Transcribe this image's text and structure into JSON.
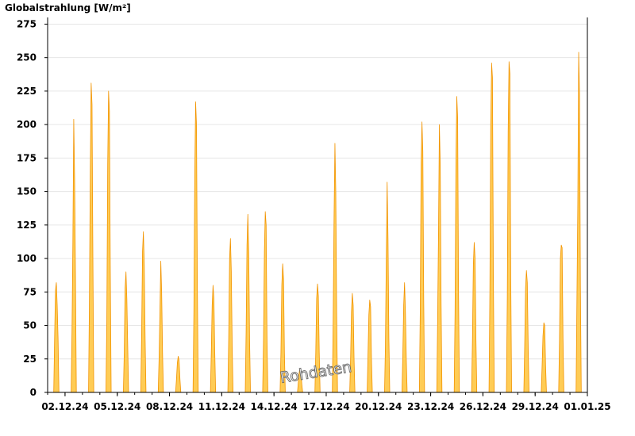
{
  "chart_data": {
    "type": "area",
    "ylabel": "Globalstrahlung [W/m²]",
    "watermark": "Rohdaten",
    "x_ticks": [
      "02.12.24",
      "05.12.24",
      "08.12.24",
      "11.12.24",
      "14.12.24",
      "17.12.24",
      "20.12.24",
      "23.12.24",
      "26.12.24",
      "29.12.24",
      "01.01.25"
    ],
    "y_ticks": [
      0,
      25,
      50,
      75,
      100,
      125,
      150,
      175,
      200,
      225,
      250,
      275
    ],
    "ylim": [
      0,
      280
    ],
    "xlim": [
      "01.12.24",
      "01.01.25"
    ],
    "grid": true,
    "colors": {
      "fill": "#ffcc55",
      "stroke": "#f29400",
      "grid": "#e6e6e6"
    },
    "series": [
      {
        "daily": [
          {
            "date": "01.12.24",
            "peak": 82,
            "shape": [
              0,
              40,
              76,
              82,
              65,
              40,
              0
            ]
          },
          {
            "date": "02.12.24",
            "peak": 204,
            "shape": [
              0,
              45,
              112,
              204,
              160,
              85,
              0
            ]
          },
          {
            "date": "03.12.24",
            "peak": 231,
            "shape": [
              0,
              70,
              165,
              231,
              215,
              100,
              0
            ]
          },
          {
            "date": "04.12.24",
            "peak": 225,
            "shape": [
              0,
              55,
              170,
              225,
              210,
              90,
              0
            ]
          },
          {
            "date": "05.12.24",
            "peak": 90,
            "shape": [
              0,
              30,
              78,
              90,
              70,
              35,
              0
            ]
          },
          {
            "date": "06.12.24",
            "peak": 120,
            "shape": [
              0,
              45,
              105,
              120,
              95,
              40,
              0
            ]
          },
          {
            "date": "07.12.24",
            "peak": 98,
            "shape": [
              0,
              25,
              60,
              98,
              75,
              30,
              0
            ]
          },
          {
            "date": "08.12.24",
            "peak": 27,
            "shape": [
              0,
              10,
              22,
              27,
              24,
              10,
              0
            ]
          },
          {
            "date": "09.12.24",
            "peak": 217,
            "shape": [
              0,
              60,
              160,
              217,
              200,
              80,
              0
            ]
          },
          {
            "date": "10.12.24",
            "peak": 80,
            "shape": [
              0,
              30,
              65,
              80,
              70,
              30,
              0
            ]
          },
          {
            "date": "11.12.24",
            "peak": 115,
            "shape": [
              0,
              40,
              100,
              115,
              90,
              35,
              0
            ]
          },
          {
            "date": "12.12.24",
            "peak": 133,
            "shape": [
              0,
              45,
              110,
              133,
              105,
              40,
              0
            ]
          },
          {
            "date": "13.12.24",
            "peak": 135,
            "shape": [
              0,
              40,
              105,
              135,
              125,
              40,
              0
            ]
          },
          {
            "date": "14.12.24",
            "peak": 96,
            "shape": [
              0,
              30,
              80,
              96,
              85,
              30,
              0
            ]
          },
          {
            "date": "15.12.24",
            "peak": 18,
            "shape": [
              0,
              8,
              15,
              18,
              15,
              6,
              0
            ]
          },
          {
            "date": "16.12.24",
            "peak": 81,
            "shape": [
              0,
              30,
              70,
              81,
              72,
              30,
              0
            ]
          },
          {
            "date": "17.12.24",
            "peak": 186,
            "shape": [
              0,
              55,
              130,
              186,
              150,
              60,
              0
            ]
          },
          {
            "date": "18.12.24",
            "peak": 74,
            "shape": [
              0,
              25,
              60,
              74,
              65,
              25,
              0
            ]
          },
          {
            "date": "19.12.24",
            "peak": 69,
            "shape": [
              0,
              28,
              58,
              69,
              64,
              25,
              0
            ]
          },
          {
            "date": "20.12.24",
            "peak": 157,
            "shape": [
              0,
              35,
              100,
              157,
              115,
              40,
              0
            ]
          },
          {
            "date": "21.12.24",
            "peak": 82,
            "shape": [
              0,
              28,
              65,
              82,
              60,
              25,
              0
            ]
          },
          {
            "date": "22.12.24",
            "peak": 202,
            "shape": [
              0,
              60,
              170,
              202,
              180,
              70,
              0
            ]
          },
          {
            "date": "23.12.24",
            "peak": 200,
            "shape": [
              0,
              55,
              120,
              200,
              170,
              65,
              0
            ]
          },
          {
            "date": "24.12.24",
            "peak": 221,
            "shape": [
              0,
              60,
              170,
              221,
              205,
              75,
              0
            ]
          },
          {
            "date": "25.12.24",
            "peak": 112,
            "shape": [
              0,
              40,
              95,
              112,
              100,
              40,
              0
            ]
          },
          {
            "date": "26.12.24",
            "peak": 246,
            "shape": [
              0,
              75,
              200,
              246,
              235,
              90,
              0
            ]
          },
          {
            "date": "27.12.24",
            "peak": 247,
            "shape": [
              0,
              70,
              195,
              247,
              238,
              85,
              0
            ]
          },
          {
            "date": "28.12.24",
            "peak": 91,
            "shape": [
              0,
              35,
              78,
              91,
              82,
              35,
              0
            ]
          },
          {
            "date": "29.12.24",
            "peak": 52,
            "shape": [
              0,
              20,
              42,
              52,
              50,
              20,
              0
            ]
          },
          {
            "date": "30.12.24",
            "peak": 110,
            "shape": [
              0,
              40,
              100,
              110,
              108,
              40,
              0
            ]
          },
          {
            "date": "31.12.24",
            "peak": 254,
            "shape": [
              0,
              70,
              140,
              254,
              222,
              80,
              0
            ]
          }
        ]
      }
    ]
  }
}
